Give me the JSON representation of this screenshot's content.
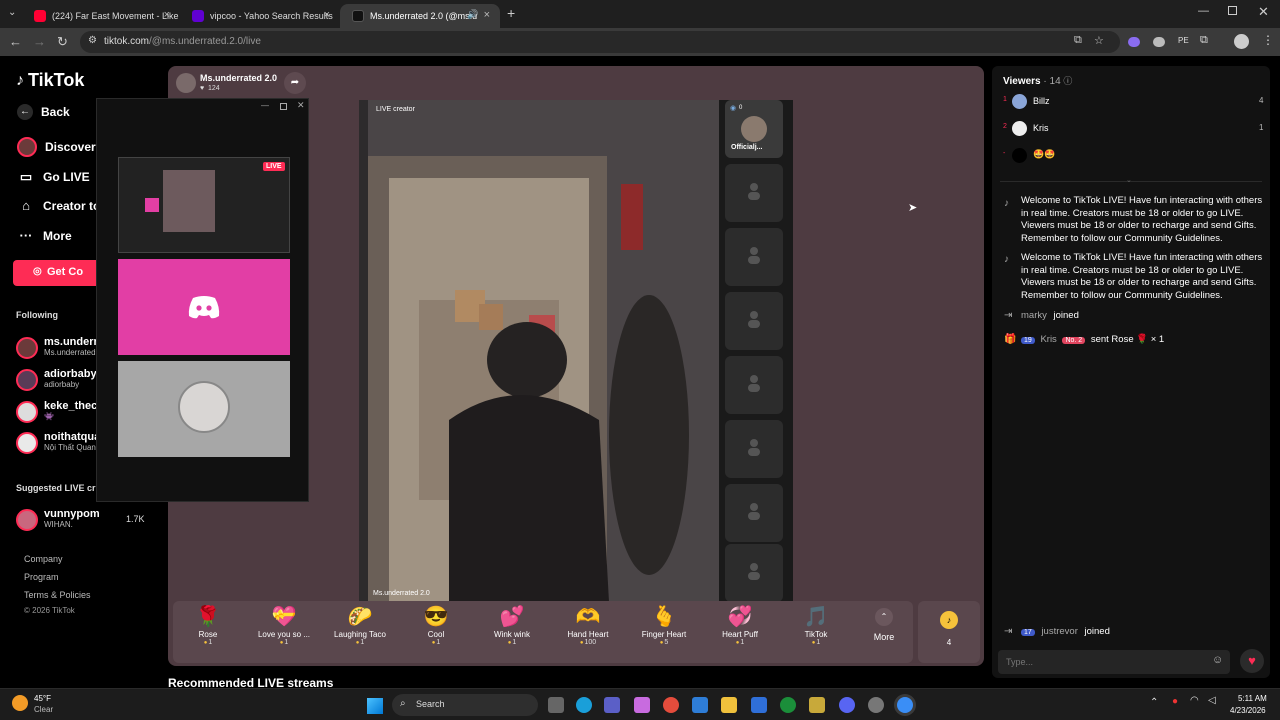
{
  "browser": {
    "tabs": [
      {
        "title": "(224) Far East Movement - Like",
        "color": "#ff0033"
      },
      {
        "title": "vipcoo - Yahoo Search Results",
        "color": "#6001d2"
      },
      {
        "title": "Ms.underrated 2.0 (@ms.u",
        "color": "#111111"
      }
    ],
    "url_host": "tiktok.com",
    "url_path": "/@ms.underrated.2.0/live"
  },
  "sidebar": {
    "logo": "TikTok",
    "back": "Back",
    "discover": "Discover Li",
    "go_live": "Go LIVE",
    "creator_tools": "Creator toc",
    "more": "More",
    "get_coins": "Get Co",
    "following_heading": "Following",
    "following": [
      {
        "name": "ms.underr",
        "sub": "Ms.underrated"
      },
      {
        "name": "adiorbaby",
        "sub": "adiorbaby"
      },
      {
        "name": "keke_theco",
        "sub": "👾"
      },
      {
        "name": "noithatqua",
        "sub": "Nội Thất Quan"
      }
    ],
    "suggested_heading": "Suggested LIVE cr",
    "suggested": [
      {
        "name": "vunnypom",
        "sub": "WIHAN.",
        "count": "1.7K"
      }
    ],
    "footer": [
      "Company",
      "Program",
      "Terms & Policies",
      "© 2026 TikTok"
    ]
  },
  "stream": {
    "host_name": "Ms.underrated 2.0",
    "likes": "124",
    "live_creator_label": "LIVE creator",
    "watermark": "Ms.underrated 2.0",
    "guest_name": "Officialj...",
    "guest_count": "0",
    "recommended": "Recommended LIVE streams"
  },
  "floating": {
    "live_badge": "LIVE"
  },
  "gifts": [
    {
      "name": "Rose",
      "price": "1",
      "glyph": "🌹"
    },
    {
      "name": "Love you so ...",
      "price": "1",
      "glyph": "💝"
    },
    {
      "name": "Laughing Taco",
      "price": "1",
      "glyph": "🌮"
    },
    {
      "name": "Cool",
      "price": "1",
      "glyph": "😎"
    },
    {
      "name": "Wink wink",
      "price": "1",
      "glyph": "💕"
    },
    {
      "name": "Hand Heart",
      "price": "100",
      "glyph": "🫶"
    },
    {
      "name": "Finger Heart",
      "price": "5",
      "glyph": "🫰"
    },
    {
      "name": "Heart Puff",
      "price": "1",
      "glyph": "💞"
    },
    {
      "name": "TikTok",
      "price": "1",
      "glyph": "🎵"
    }
  ],
  "gift_more": "More",
  "coins_label": "4",
  "chat": {
    "viewers_label": "Viewers",
    "viewers_count": "· 14",
    "viewers": [
      {
        "rank": "1",
        "name": "Billz",
        "score": "4"
      },
      {
        "rank": "2",
        "name": "Kris",
        "score": "1"
      },
      {
        "rank": "-",
        "name": "🤩🤩",
        "score": ""
      }
    ],
    "welcome": "Welcome to TikTok LIVE! Have fun interacting with others in real time. Creators must be 18 or older to go LIVE. Viewers must be 18 or older to recharge and send Gifts. Remember to follow our Community Guidelines.",
    "join1_user": "marky",
    "join1_text": "joined",
    "gift_level": "19",
    "gift_user": "Kris",
    "gift_badge": "No. 2",
    "gift_text": "sent Rose",
    "gift_glyph": "🌹",
    "gift_count": "× 1",
    "join2_level": "17",
    "join2_user": "justrevor",
    "join2_text": "joined",
    "input_placeholder": "Type..."
  },
  "weather": {
    "temp": "45°F",
    "cond": "Clear"
  },
  "taskbar": {
    "search": "Search",
    "time": "5:11 AM",
    "date": "4/23/2026"
  },
  "colors": {
    "brand": "#fe2c55",
    "stage": "#4e3b41",
    "chat_bg": "#121212"
  }
}
